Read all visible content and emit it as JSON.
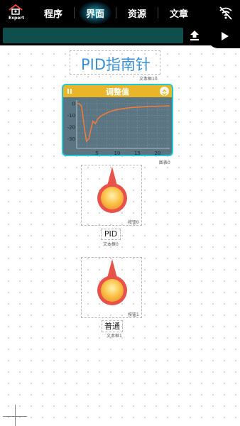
{
  "app": {
    "logo_text": "Expert",
    "tabs": [
      {
        "label": "程序",
        "active": false
      },
      {
        "label": "界面",
        "active": true
      },
      {
        "label": "资源",
        "active": false
      },
      {
        "label": "文章",
        "active": false
      }
    ],
    "icons": {
      "logo": "house-logo-icon",
      "status": "wifi-off-icon",
      "upload": "upload-icon",
      "run": "play-icon"
    },
    "accent": "#22c8d2"
  },
  "canvas": {
    "title_widget": {
      "text": "PID指南针",
      "caption": "文本框10"
    },
    "chart_widget": {
      "header": "调整值",
      "caption": "图表0",
      "header_color": "#e9b62a",
      "plot_bg": "#5b7582",
      "line_color": "#f07a3c"
    },
    "knob1": {
      "caption": "按钮0",
      "label": "PID",
      "label_caption": "文本框0"
    },
    "knob2": {
      "caption": "按钮1",
      "label": "普通",
      "label_caption": "文本框1"
    }
  },
  "chart_data": {
    "type": "line",
    "title": "调整值",
    "x_ticks": [
      5,
      10,
      15,
      20
    ],
    "y_ticks": [
      0,
      -10,
      -20,
      -30
    ],
    "xlim": [
      0,
      23
    ],
    "ylim": [
      -38,
      3
    ],
    "grid": true,
    "series": [
      {
        "x": [
          0,
          0.6,
          1.2,
          1.8,
          2.4,
          3.0,
          3.5,
          4.0,
          4.6,
          5.2,
          6,
          7,
          8,
          9,
          10,
          11,
          12,
          13,
          14,
          15,
          16,
          17,
          18,
          19,
          20,
          21,
          22,
          23
        ],
        "y": [
          0,
          0,
          -2,
          -18,
          -32,
          -30,
          -22,
          -15,
          -17,
          -13,
          -10.5,
          -8.5,
          -7,
          -6,
          -5,
          -4.5,
          -4,
          -3.5,
          -3.2,
          -3,
          -2.8,
          -2.6,
          -2.4,
          -2.3,
          -2.2,
          -2.1,
          -2,
          -2
        ]
      }
    ]
  }
}
